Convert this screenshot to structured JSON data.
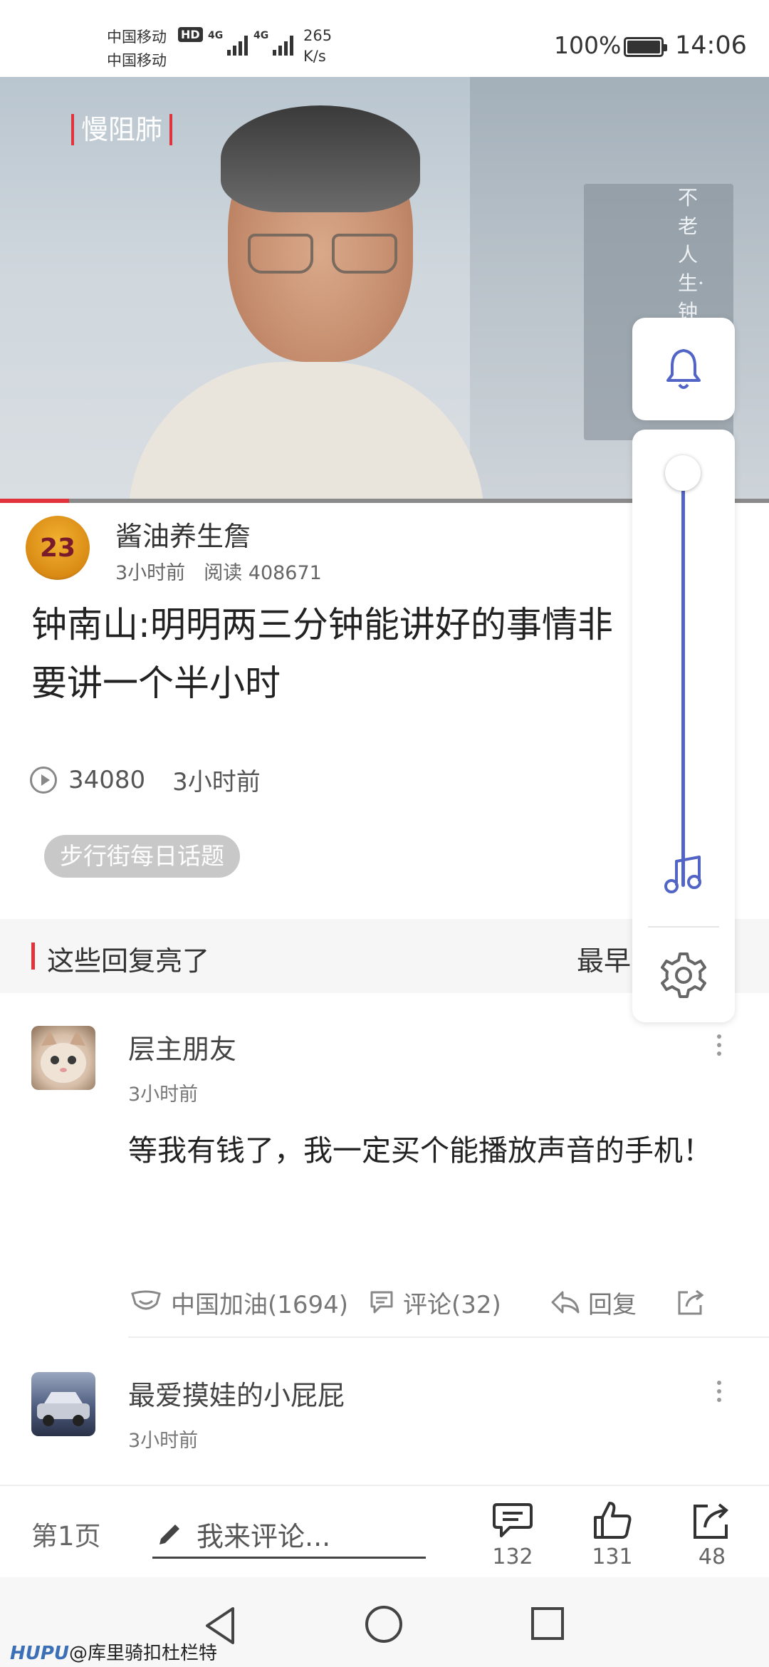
{
  "status_bar": {
    "carrier_1": "中国移动",
    "carrier_2": "中国移动",
    "hd": "HD",
    "network_1": "4G",
    "network_2": "4G",
    "speed_value": "265",
    "speed_unit": "K/s",
    "battery": "100%",
    "time": "14:06"
  },
  "video": {
    "tag": "慢阻肺",
    "background_text": "不老人生·钟",
    "progress_fraction": 0.09
  },
  "post": {
    "author": "酱油养生詹",
    "author_avatar_text": "23",
    "time_ago": "3小时前",
    "reads": "阅读 408671",
    "title": "钟南山:明明两三分钟能讲好的事情非要讲一个半小时",
    "plays": "34080",
    "play_time": "3小时前",
    "topic": "步行街每日话题"
  },
  "section": {
    "title": "这些回复亮了",
    "sort": "最早"
  },
  "comments": [
    {
      "name": "层主朋友",
      "time": "3小时前",
      "body": "等我有钱了，我一定买个能播放声音的手机！",
      "like": "中国加油(1694)",
      "comment": "评论(32)",
      "reply": "回复"
    },
    {
      "name": "最爱摸娃的小屁屁",
      "time": "3小时前"
    }
  ],
  "bottom": {
    "page": "第1页",
    "input_placeholder": "我来评论...",
    "comments_count": "132",
    "likes_count": "131",
    "shares_count": "48"
  },
  "panel": {
    "volume_level": 0.0
  },
  "watermark": {
    "brand": "HUPU",
    "handle": "@库里骑扣杜栏特"
  },
  "colors": {
    "accent_red": "#e0333c",
    "panel_blue": "#5264c5"
  }
}
